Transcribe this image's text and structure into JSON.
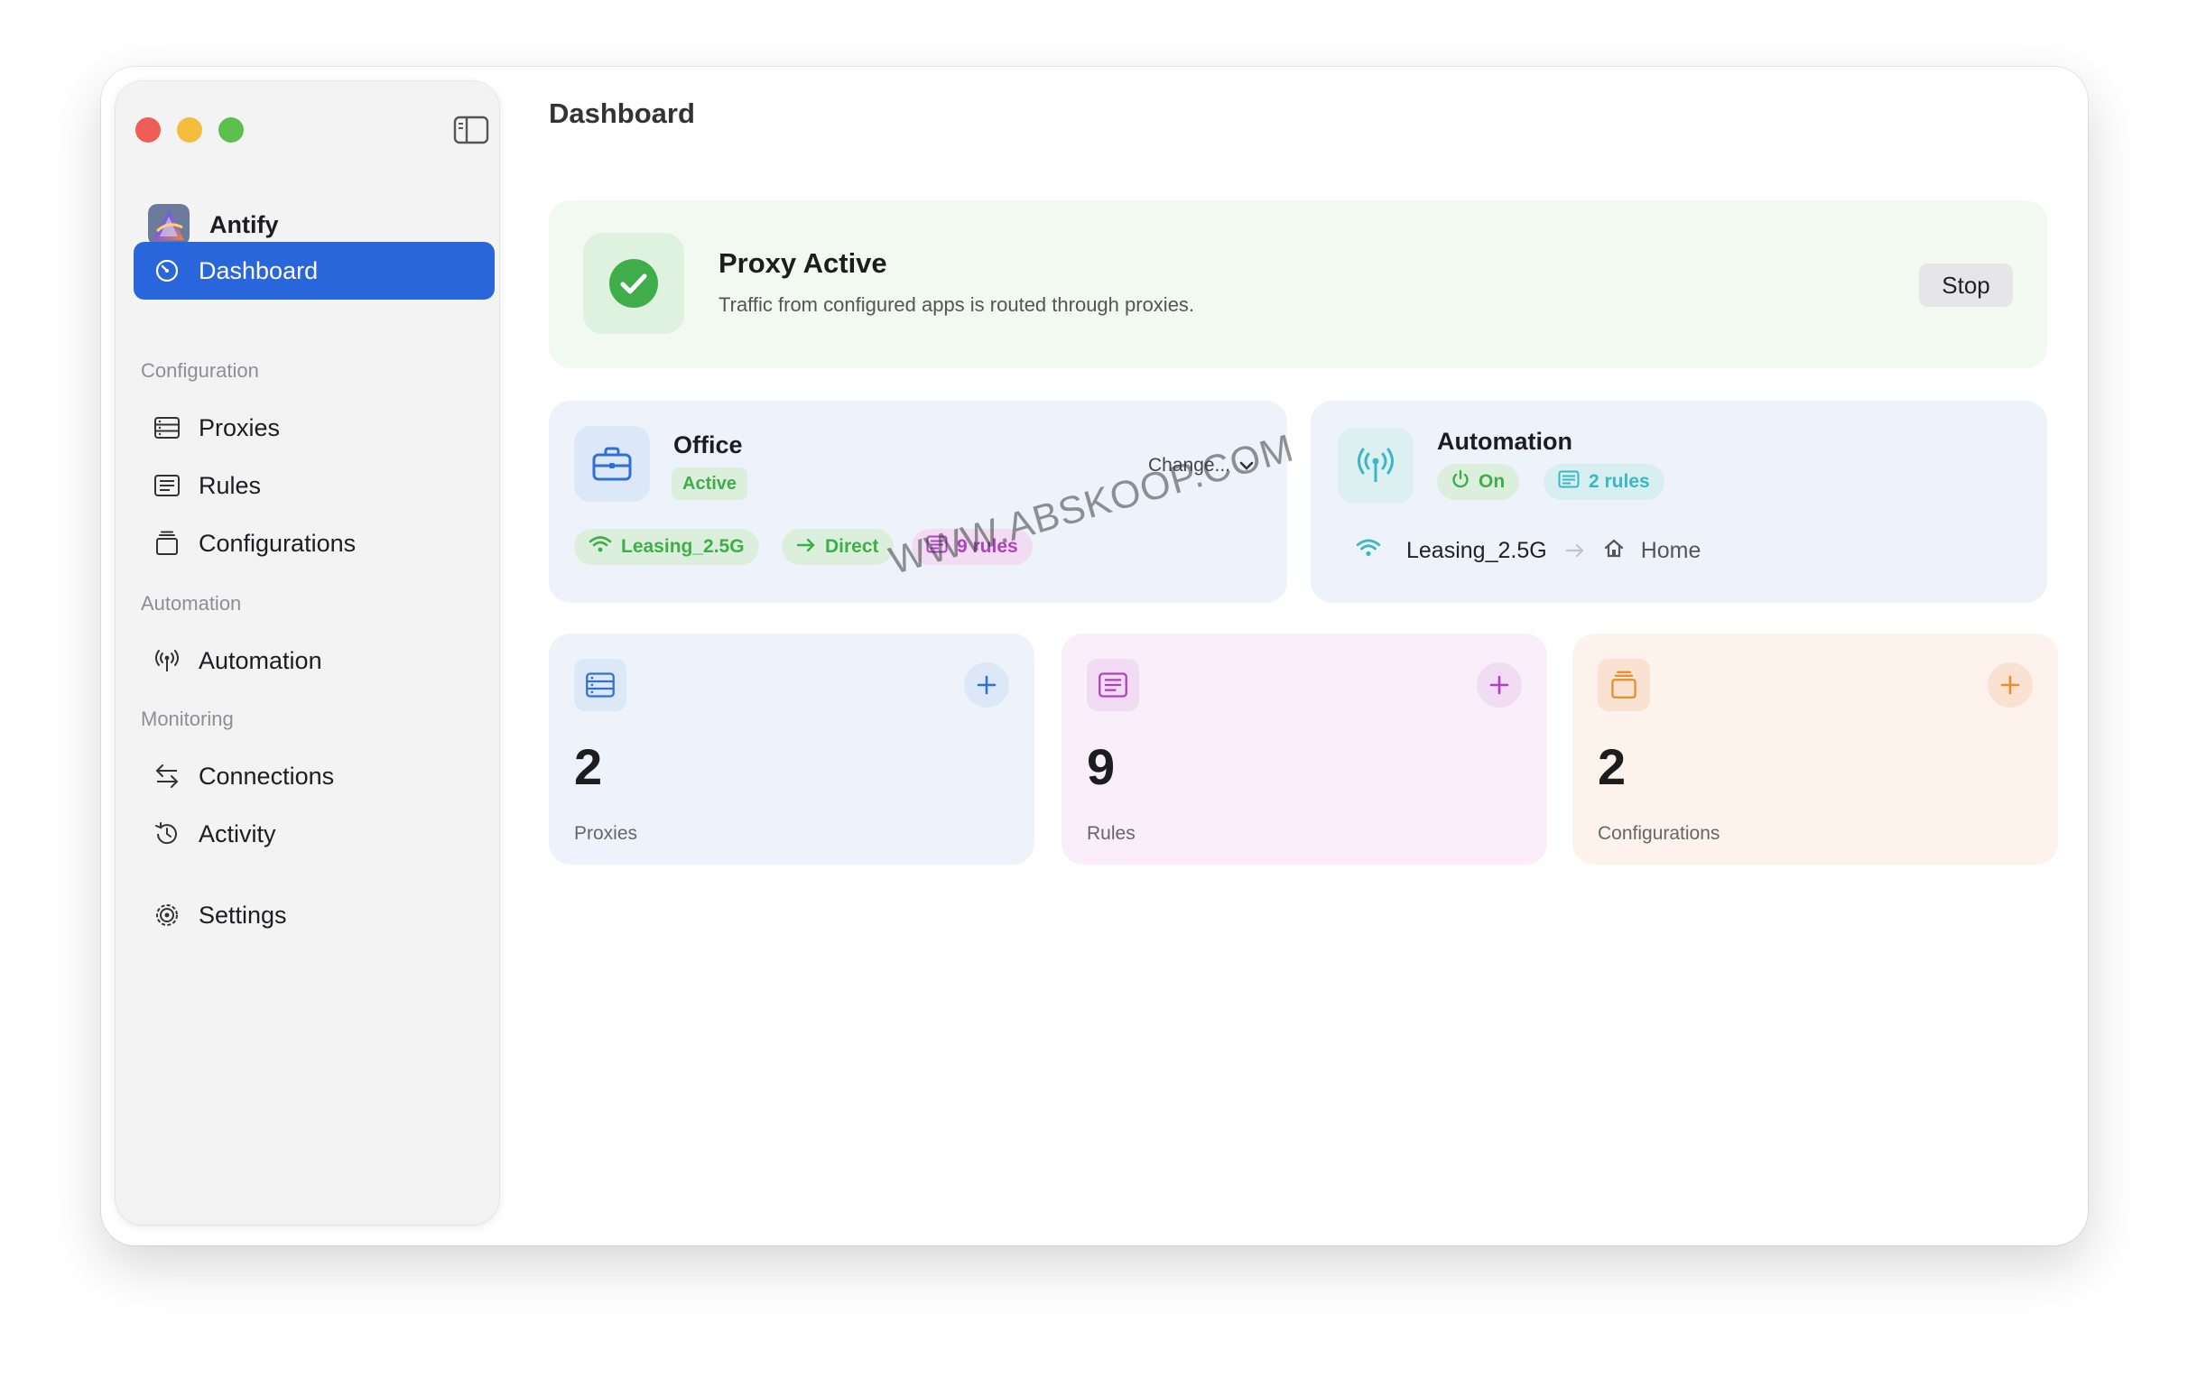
{
  "app": {
    "name": "Antify"
  },
  "page": {
    "title": "Dashboard"
  },
  "sidebar": {
    "primary": {
      "label": "Dashboard"
    },
    "sections": {
      "configuration": "Configuration",
      "automation": "Automation",
      "monitoring": "Monitoring"
    },
    "items": {
      "proxies": "Proxies",
      "rules": "Rules",
      "configurations": "Configurations",
      "automation": "Automation",
      "connections": "Connections",
      "activity": "Activity",
      "settings": "Settings"
    }
  },
  "proxy_status": {
    "title": "Proxy Active",
    "subtitle": "Traffic from configured apps is routed through proxies.",
    "stop_label": "Stop"
  },
  "office": {
    "name": "Office",
    "status": "Active",
    "change_label": "Change...",
    "network": "Leasing_2.5G",
    "mode": "Direct",
    "rules": "9 rules"
  },
  "automation_card": {
    "title": "Automation",
    "state": "On",
    "rules": "2 rules",
    "network": "Leasing_2.5G",
    "target": "Home"
  },
  "stats": [
    {
      "value": "2",
      "label": "Proxies"
    },
    {
      "value": "9",
      "label": "Rules"
    },
    {
      "value": "2",
      "label": "Configurations"
    }
  ],
  "watermark": "WWW.ABSKOOP.COM",
  "colors": {
    "accent": "#2966db",
    "active_green": "#3fae4a",
    "rules_purple": "#b13fc4",
    "config_orange": "#e88c2c",
    "automation_teal": "#3bb7c4"
  }
}
